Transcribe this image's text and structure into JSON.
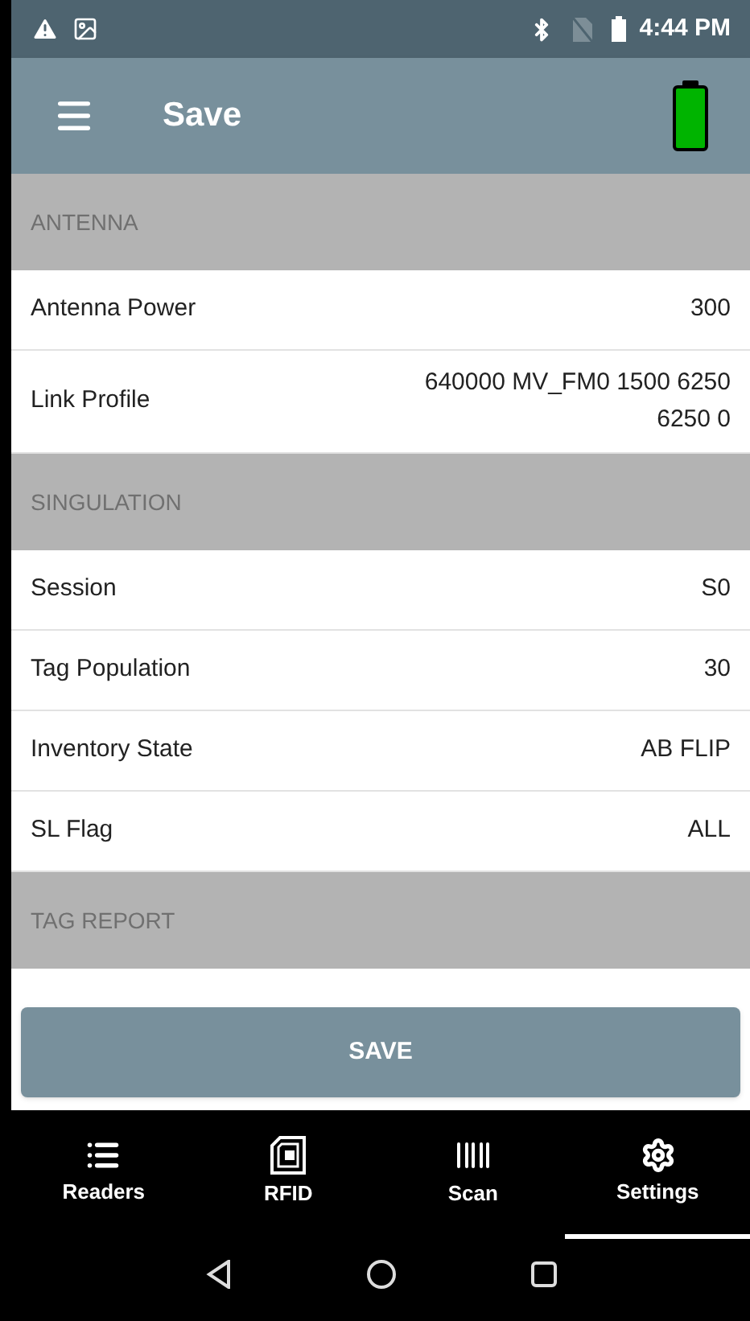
{
  "status_bar": {
    "time": "4:44 PM"
  },
  "toolbar": {
    "title": "Save"
  },
  "sections": [
    {
      "header": "ANTENNA",
      "rows": [
        {
          "label": "Antenna Power",
          "value": "300"
        },
        {
          "label": "Link Profile",
          "value": "640000 MV_FM0 1500 6250 6250 0"
        }
      ]
    },
    {
      "header": "SINGULATION",
      "rows": [
        {
          "label": "Session",
          "value": "S0"
        },
        {
          "label": "Tag Population",
          "value": "30"
        },
        {
          "label": "Inventory State",
          "value": "AB FLIP"
        },
        {
          "label": "SL Flag",
          "value": "ALL"
        }
      ]
    },
    {
      "header": "TAG REPORT"
    }
  ],
  "save_button": "SAVE",
  "bottom_nav": [
    {
      "label": "Readers",
      "kind": "list",
      "selected": false
    },
    {
      "label": "RFID",
      "kind": "chip",
      "selected": false
    },
    {
      "label": "Scan",
      "kind": "barcode",
      "selected": false
    },
    {
      "label": "Settings",
      "kind": "gear",
      "selected": true
    }
  ]
}
